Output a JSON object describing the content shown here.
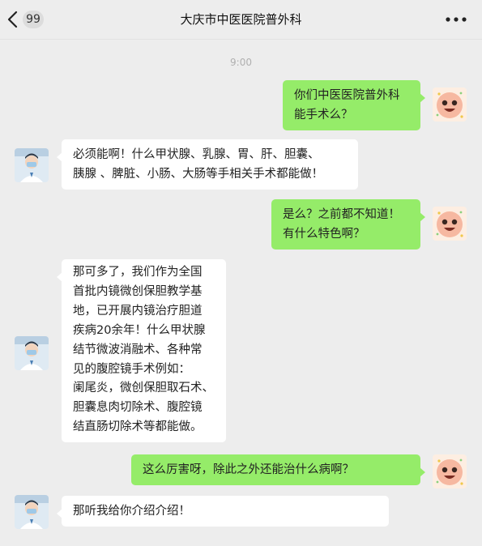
{
  "header": {
    "unread_count": "99",
    "title": "大庆市中医医院普外科"
  },
  "timestamp": "9:00",
  "messages": [
    {
      "from": "me",
      "text": "你们中医医院普外科\n能手术么？"
    },
    {
      "from": "them",
      "text": "必须能啊！什么甲状腺、乳腺、胃、肝、胆囊、\n胰腺 、脾脏、小肠、大肠等手相关手术都能做！"
    },
    {
      "from": "me",
      "text": "是么？之前都不知道！\n有什么特色啊？"
    },
    {
      "from": "them",
      "text": "那可多了，我们作为全国\n首批内镜微创保胆教学基\n地，已开展内镜治疗胆道\n疾病20余年！什么甲状腺\n结节微波消融术、各种常\n见的腹腔镜手术例如：\n阑尾炎，微创保胆取石术、\n胆囊息肉切除术、腹腔镜\n结直肠切除术等都能做。"
    },
    {
      "from": "me",
      "text": "这么厉害呀，除此之外还能治什么病啊？"
    },
    {
      "from": "them",
      "text": "那听我给你介绍介绍！"
    }
  ],
  "colors": {
    "background": "#ededed",
    "my_bubble": "#95ec69",
    "their_bubble": "#ffffff"
  }
}
